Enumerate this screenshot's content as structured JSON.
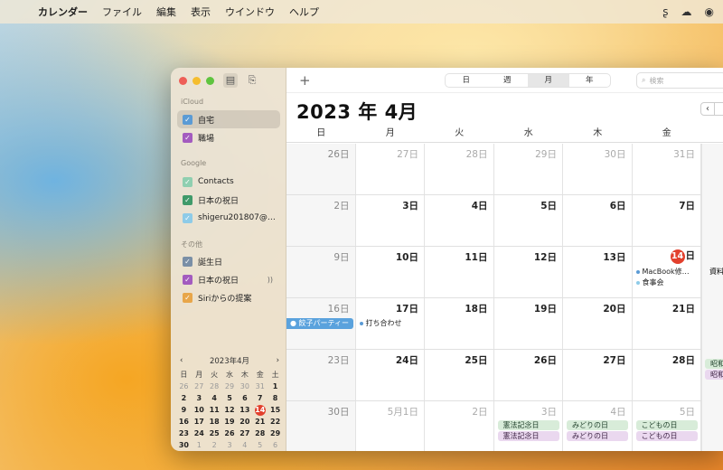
{
  "menubar": {
    "apple": "",
    "app": "カレンダー",
    "items": [
      "ファイル",
      "編集",
      "表示",
      "ウインドウ",
      "ヘルプ"
    ],
    "right_icons": [
      "status-s-icon",
      "creative-cloud-icon",
      "user-account-icon"
    ]
  },
  "sidebar": {
    "groups": [
      {
        "title": "iCloud",
        "items": [
          {
            "label": "自宅",
            "color": "#5b9bd5",
            "selected": true
          },
          {
            "label": "職場",
            "color": "#a35bbf"
          }
        ]
      },
      {
        "title": "Google",
        "items": [
          {
            "label": "Contacts",
            "color": "#8fcfb0"
          },
          {
            "label": "日本の祝日",
            "color": "#3f9a6a"
          },
          {
            "label": "shigeru201807@g...",
            "color": "#8ecbe8"
          }
        ]
      },
      {
        "title": "その他",
        "items": [
          {
            "label": "誕生日",
            "color": "#7a8fa6"
          },
          {
            "label": "日本の祝日",
            "color": "#a35bbf"
          },
          {
            "label": "Siriからの提案",
            "color": "#e8a64a"
          }
        ]
      }
    ],
    "mini": {
      "title": "2023年4月",
      "weekdays": [
        "日",
        "月",
        "火",
        "水",
        "木",
        "金",
        "土"
      ],
      "days": [
        [
          "26",
          "27",
          "28",
          "29",
          "30",
          "31",
          "1"
        ],
        [
          "2",
          "3",
          "4",
          "5",
          "6",
          "7",
          "8"
        ],
        [
          "9",
          "10",
          "11",
          "12",
          "13",
          "14",
          "15"
        ],
        [
          "16",
          "17",
          "18",
          "19",
          "20",
          "21",
          "22"
        ],
        [
          "23",
          "24",
          "25",
          "26",
          "27",
          "28",
          "29"
        ],
        [
          "30",
          "1",
          "2",
          "3",
          "4",
          "5",
          "6"
        ]
      ],
      "today": "14"
    }
  },
  "toolbar": {
    "add": "+",
    "views": [
      "日",
      "週",
      "月",
      "年"
    ],
    "active_view": "月",
    "search_placeholder": "検索",
    "month_title": "2023 年 4月"
  },
  "weekdays": [
    "日",
    "月",
    "火",
    "水",
    "木",
    "金"
  ],
  "weeks": [
    [
      "26日",
      "27日",
      "28日",
      "29日",
      "30日",
      "31日"
    ],
    [
      "2日",
      "3日",
      "4日",
      "5日",
      "6日",
      "7日"
    ],
    [
      "9日",
      "10日",
      "11日",
      "12日",
      "13日",
      "日"
    ],
    [
      "16日",
      "17日",
      "18日",
      "19日",
      "20日",
      "21日"
    ],
    [
      "23日",
      "24日",
      "25日",
      "26日",
      "27日",
      "28日"
    ],
    [
      "30日",
      "5月1日",
      "2日",
      "3日",
      "4日",
      "5日"
    ]
  ],
  "events": {
    "macbook": "MacBook修…",
    "dinner": "食事会",
    "party": "餃子パーティー",
    "meeting": "打ち合わせ",
    "kenpo1": "憲法記念日",
    "kenpo2": "憲法記念日",
    "midori1": "みどりの日",
    "midori2": "みどりの日",
    "kodomo1": "こどもの日",
    "kodomo2": "こどもの日",
    "edge1": "資料",
    "edge2": "昭和",
    "edge3": "昭和"
  },
  "today_badge": "14"
}
